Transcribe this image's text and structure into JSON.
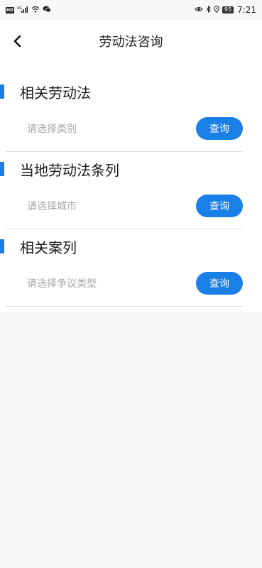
{
  "status_bar": {
    "hd": "HD",
    "signal": "⁴ᴳ",
    "battery": "95",
    "time": "7:21"
  },
  "header": {
    "title": "劳动法咨询"
  },
  "sections": [
    {
      "title": "相关劳动法",
      "placeholder": "请选择类别",
      "button": "查询"
    },
    {
      "title": "当地劳动法条列",
      "placeholder": "请选择城市",
      "button": "查询"
    },
    {
      "title": "相关案列",
      "placeholder": "请选择争议类型",
      "button": "查询"
    }
  ],
  "colors": {
    "accent": "#1a7fe6",
    "page_bg": "#f6f6f6",
    "card_bg": "#ffffff",
    "placeholder": "#a6a6a6"
  },
  "icons": {
    "back": "chevron-left-icon",
    "wifi": "wifi-icon",
    "chat": "wechat-icon",
    "eye": "eye-icon",
    "bluetooth": "bluetooth-icon",
    "location": "location-icon"
  }
}
